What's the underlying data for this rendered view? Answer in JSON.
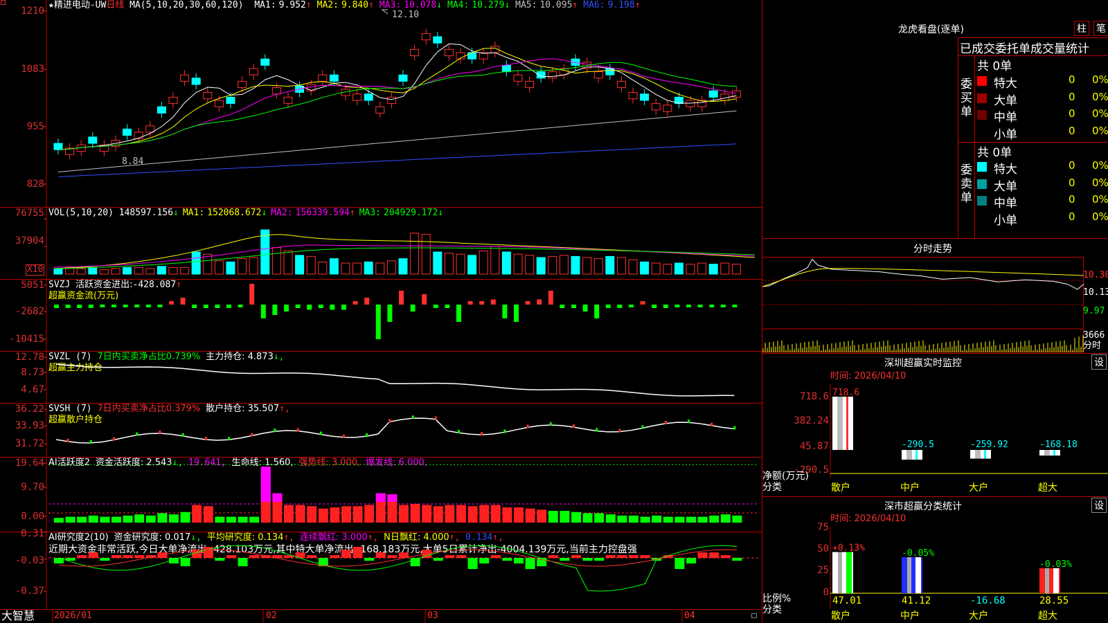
{
  "header": {
    "star": "★",
    "name": "精进电动-UW",
    "period": "日线",
    "ma_params": "MA(5,10,20,30,60,120)",
    "ma": [
      {
        "label": "MA1:",
        "value": "9.952",
        "arrow": "↑",
        "color": "#ffffff"
      },
      {
        "label": "MA2:",
        "value": "9.840",
        "arrow": "↑",
        "color": "#ffff00"
      },
      {
        "label": "MA3:",
        "value": "10.078",
        "arrow": "↓",
        "color": "#ff00ff"
      },
      {
        "label": "MA4:",
        "value": "10.279",
        "arrow": "↓",
        "color": "#00ff00"
      },
      {
        "label": "MA5:",
        "value": "10.095",
        "arrow": "↑",
        "color": "#c0c0c0"
      },
      {
        "label": "MA6:",
        "value": "9.198",
        "arrow": "↑",
        "color": "#3050ff"
      }
    ]
  },
  "price_pane": {
    "y_ticks": [
      "1210",
      "1083",
      "955",
      "828"
    ],
    "high_label": "12.10",
    "low_label": "8.84"
  },
  "vol_pane": {
    "title": "VOL(5,10,20)",
    "value": "148597.156",
    "arrow": "↓",
    "ma": [
      {
        "label": "MA1:",
        "value": "152068.672",
        "arrow": "↓",
        "color": "#ffff00"
      },
      {
        "label": "MA2:",
        "value": "156339.594",
        "arrow": "↑",
        "color": "#ff00ff"
      },
      {
        "label": "MA3:",
        "value": "204929.172",
        "arrow": "↓",
        "color": "#00ff00"
      }
    ],
    "y_ticks": [
      "76755",
      "37904"
    ],
    "unit": "X10"
  },
  "svzj_pane": {
    "title": "SVZJ",
    "label": "活跃资金进出:",
    "value": "-428.087",
    "arrow": "↑",
    "subtitle": "超赢资金流(万元)",
    "y_ticks": [
      "5051",
      "-2682",
      "-10415"
    ]
  },
  "svzl_pane": {
    "title": "SVZL (7)",
    "seg1": "7日内买卖净占比0.739%",
    "seg2": "主力持仓: 4.873",
    "arrow": "↓,",
    "subtitle": "超赢主力持仓",
    "y_ticks": [
      "12.78",
      "8.73",
      "4.67"
    ]
  },
  "svsh_pane": {
    "title": "SVSH (7)",
    "seg1": "7日内买卖净占比0.379%",
    "seg2": "散户持仓: 35.507",
    "arrow": "↑,",
    "subtitle": "超赢散户持仓",
    "y_ticks": [
      "36.22",
      "33.93",
      "31.72"
    ]
  },
  "ai_pane": {
    "title": "AI活跃度2",
    "seg1": "资金活跃度: 2.543",
    "a1": "↓,",
    "seg2": "19.641,",
    "seg3": "生命线: 1.560,",
    "seg4": "强势线: 3.000,",
    "seg5": "爆发线: 6.000,",
    "y_ticks": [
      "19.64",
      "9.70",
      "0.00"
    ]
  },
  "ai_research": {
    "title": "AI研究度2(10)",
    "seg1": "资金研究度: 0.017",
    "a1": "↓,",
    "seg2": "平均研究度: 0.134",
    "a2": "↑,",
    "seg3": "连续飘红: 3.000",
    "a3": "↑,",
    "seg4": "N日飘红: 4.000",
    "a4": "↑,",
    "seg5": "0.134",
    "a5": "↑,",
    "message": "近期大资金非常活跃,今日大单净流出:-428.103万元,其中特大单净流出:-168.183万元,大单5日累计净出-4004.139万元,当前主力控盘强",
    "y_ticks": [
      "0.31",
      "-0.03",
      "-0.37"
    ]
  },
  "xaxis": {
    "brand": "大智慧",
    "labels": [
      "2026/01",
      "02",
      "03",
      "04"
    ]
  },
  "right": {
    "title": "龙虎看盘(逐单)",
    "btn1": "柱",
    "btn2": "笔",
    "sub": "已成交委托单成交量统计",
    "buy_label": "委买单",
    "sell_label": "委卖单",
    "buy_total": "共 0单",
    "sell_total": "共 0单",
    "buy_rows": [
      {
        "name": "特大",
        "qty": "0",
        "pct": "0%",
        "color": "#ff0000"
      },
      {
        "name": "大单",
        "qty": "0",
        "pct": "0%",
        "color": "#a00000"
      },
      {
        "name": "中单",
        "qty": "0",
        "pct": "0%",
        "color": "#700000"
      },
      {
        "name": "小单",
        "qty": "0",
        "pct": "0%",
        "color": "#000000"
      }
    ],
    "sell_rows": [
      {
        "name": "特大",
        "qty": "0",
        "pct": "0%",
        "color": "#00ffff"
      },
      {
        "name": "大单",
        "qty": "0",
        "pct": "0%",
        "color": "#00a0a0"
      },
      {
        "name": "中单",
        "qty": "0",
        "pct": "0%",
        "color": "#008080"
      },
      {
        "name": "小单",
        "qty": "0",
        "pct": "0%",
        "color": "#000000"
      }
    ],
    "intraday": {
      "title": "分时走势",
      "y_ticks": [
        "10.30",
        "10.13",
        "9.97"
      ],
      "vol_label": "3666",
      "vol_unit": "分时"
    },
    "sz_monitor": {
      "title": "深圳超赢实时监控",
      "btn": "设",
      "date": "时间: 2026/04/10",
      "y_ticks": [
        "718.6",
        "382.24",
        "45.87",
        "-290.5"
      ],
      "bars": [
        {
          "cat": "散户",
          "value": 718.6,
          "label": "718.6"
        },
        {
          "cat": "中户",
          "value": -290.5,
          "label": "-290.5"
        },
        {
          "cat": "大户",
          "value": -259.92,
          "label": "-259.92"
        },
        {
          "cat": "超大",
          "value": -168.18,
          "label": "-168.18"
        }
      ],
      "ylab1": "净额(万元)",
      "ylab2": "分类"
    },
    "sz_class": {
      "title": "深市超赢分类统计",
      "btn": "设",
      "date": "时间: 2026/04/10",
      "y_ticks": [
        "75",
        "50",
        "25",
        "0"
      ],
      "bars": [
        {
          "cat": "散户",
          "value": 47.01,
          "label": "47.01",
          "top": "+0.13%"
        },
        {
          "cat": "中户",
          "value": 41.12,
          "label": "41.12",
          "top": "-0.05%"
        },
        {
          "cat": "大户",
          "value": -16.68,
          "label": "-16.68",
          "top": ""
        },
        {
          "cat": "超大",
          "value": 28.55,
          "label": "28.55",
          "top": "-0.03%"
        }
      ],
      "ylab1": "比例%",
      "ylab2": "分类"
    }
  }
}
